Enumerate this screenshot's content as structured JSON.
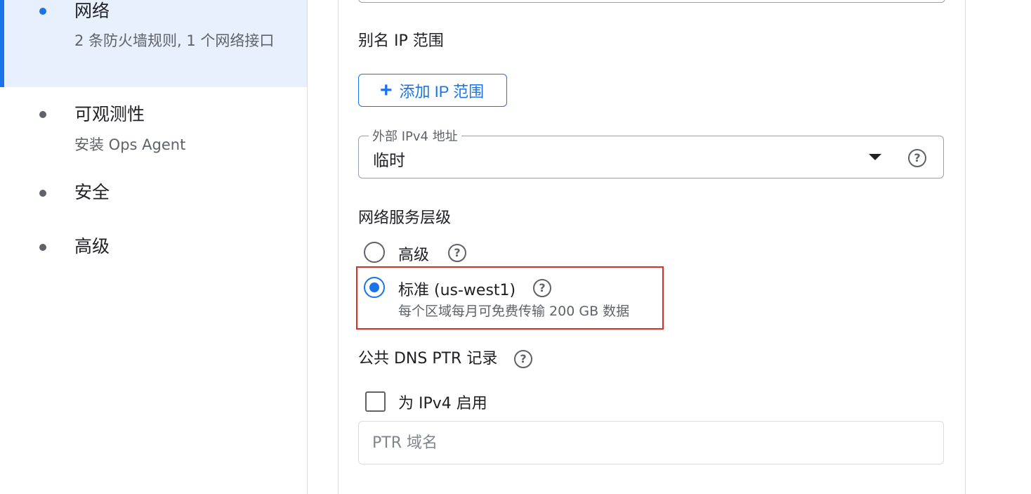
{
  "sidebar": {
    "items": [
      {
        "title": "网络",
        "subtitle": "2 条防火墙规则, 1 个网络接口",
        "active": true
      },
      {
        "title": "可观测性",
        "subtitle": "安装 Ops Agent"
      },
      {
        "title": "安全"
      },
      {
        "title": "高级"
      }
    ]
  },
  "form": {
    "alias_ip": {
      "label": "别名 IP 范围",
      "add_button": "添加 IP 范围",
      "add_icon": "plus-icon"
    },
    "external_ip": {
      "legend": "外部 IPv4 地址",
      "value": "临时"
    },
    "network_tier": {
      "label": "网络服务层级",
      "options": [
        {
          "label": "高级",
          "selected": false
        },
        {
          "label": "标准 (us-west1)",
          "description": "每个区域每月可免费传输 200 GB 数据",
          "selected": true
        }
      ]
    },
    "ptr": {
      "label": "公共 DNS PTR 记录",
      "checkbox_label": "为 IPv4 启用",
      "checked": false,
      "placeholder": "PTR 域名",
      "value": ""
    }
  },
  "colors": {
    "accent": "#1a73e8",
    "highlight": "#d93025",
    "active_bg": "#e8f0fe"
  }
}
